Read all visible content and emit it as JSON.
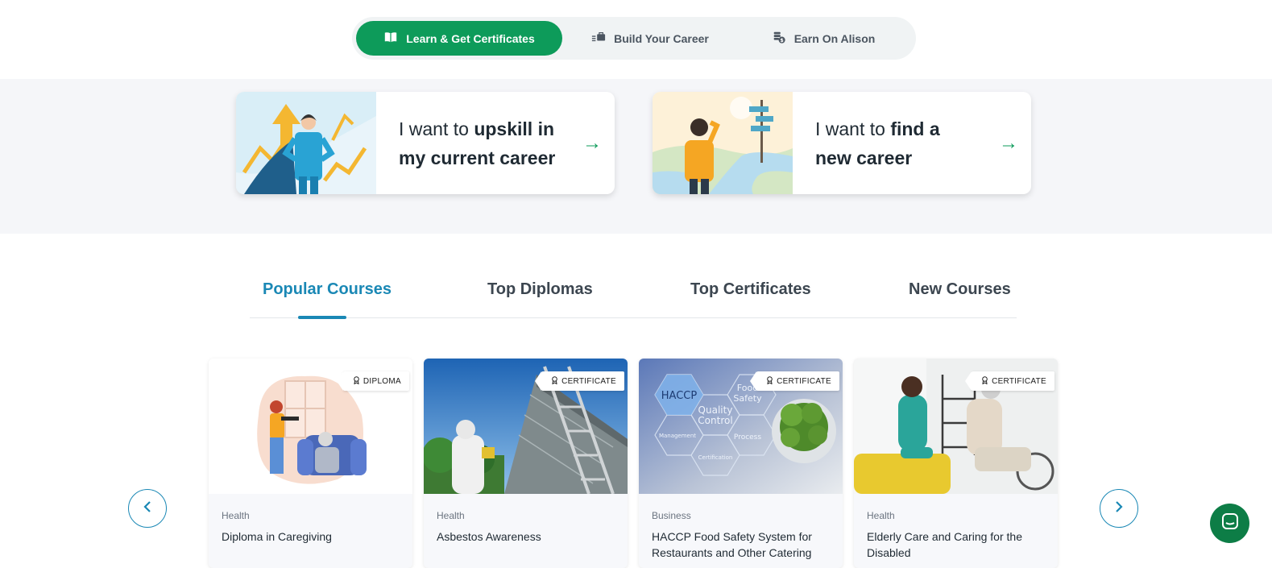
{
  "top_nav": {
    "items": [
      {
        "label": "Learn & Get Certificates",
        "icon": "open-book-icon",
        "active": true
      },
      {
        "label": "Build Your Career",
        "icon": "briefcase-icon",
        "active": false
      },
      {
        "label": "Earn On Alison",
        "icon": "coins-icon",
        "active": false
      }
    ]
  },
  "career_cards": [
    {
      "text_plain": "I want to ",
      "text_bold_1": "upskill in",
      "text_bold_2": "my current career",
      "arrow": "→"
    },
    {
      "text_plain": "I want to ",
      "text_bold_1": "find a",
      "text_bold_2": "new career",
      "arrow": "→"
    }
  ],
  "tabs": [
    {
      "label": "Popular Courses",
      "active": true
    },
    {
      "label": "Top Diplomas",
      "active": false
    },
    {
      "label": "Top Certificates",
      "active": false
    },
    {
      "label": "New Courses",
      "active": false
    }
  ],
  "courses": [
    {
      "badge": "DIPLOMA",
      "category": "Health",
      "title": "Diploma in Caregiving"
    },
    {
      "badge": "CERTIFICATE",
      "category": "Health",
      "title": "Asbestos Awareness"
    },
    {
      "badge": "CERTIFICATE",
      "category": "Business",
      "title": "HACCP Food Safety System for Restaurants and Other Catering"
    },
    {
      "badge": "CERTIFICATE",
      "category": "Health",
      "title": "Elderly Care and Caring for the Disabled"
    }
  ],
  "haccp_labels": {
    "a": "HACCP",
    "b": "Quality",
    "c": "Control",
    "d": "Food",
    "e": "Safety",
    "f": "Process",
    "g": "Management",
    "h": "Certification"
  },
  "colors": {
    "brand_green": "#0d9b5a",
    "accent_blue": "#1a88b5",
    "chat_green": "#0d7d46"
  }
}
